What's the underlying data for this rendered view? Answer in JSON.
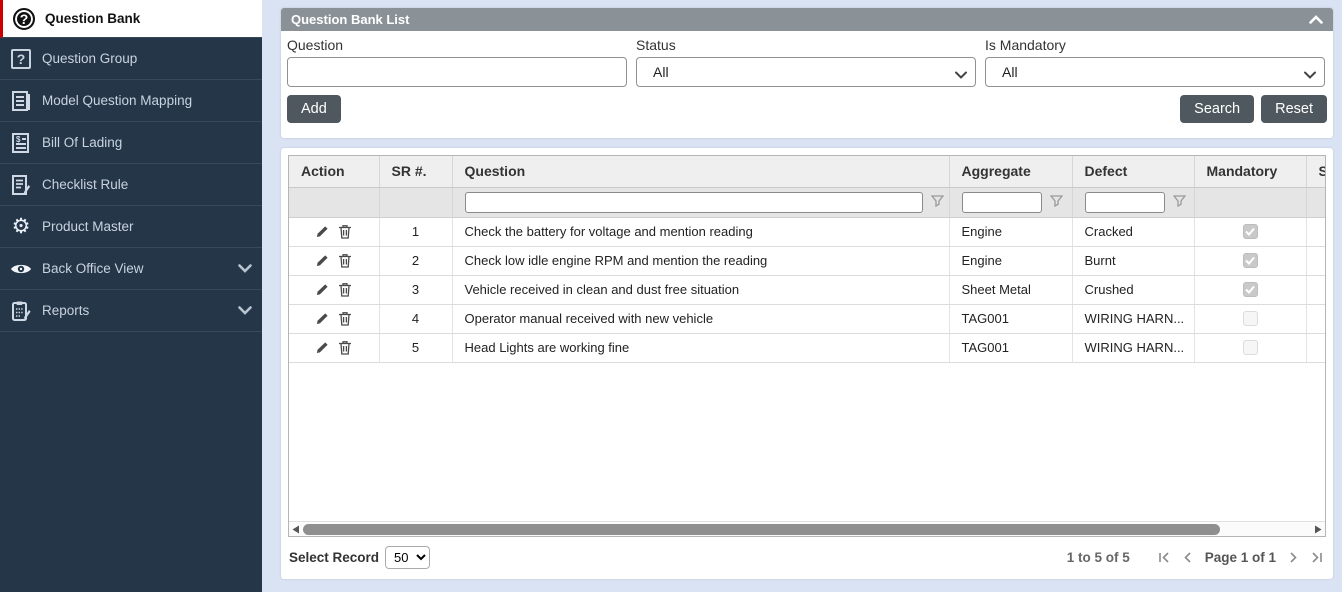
{
  "colors": {
    "sidebar_bg": "#253649",
    "active_accent": "#cc0000",
    "panel_header_bg": "#8a9298",
    "page_bg": "#d9e3f3",
    "button_bg": "#4f585f",
    "table_header_bg": "#efefef"
  },
  "sidebar": {
    "items": [
      {
        "label": "Question Bank",
        "icon": "question-circle-icon",
        "active": true
      },
      {
        "label": "Question Group",
        "icon": "question-square-icon",
        "active": false
      },
      {
        "label": "Model Question Mapping",
        "icon": "document-lines-icon",
        "active": false
      },
      {
        "label": "Bill Of Lading",
        "icon": "document-dollar-icon",
        "active": false
      },
      {
        "label": "Checklist Rule",
        "icon": "document-edit-icon",
        "active": false
      },
      {
        "label": "Product Master",
        "icon": "gear-icon",
        "active": false
      },
      {
        "label": "Back Office View",
        "icon": "eye-icon",
        "active": false,
        "expandable": true
      },
      {
        "label": "Reports",
        "icon": "clipboard-edit-icon",
        "active": false,
        "expandable": true
      }
    ]
  },
  "panel": {
    "title": "Question Bank List",
    "filters": {
      "question_label": "Question",
      "question_value": "",
      "status_label": "Status",
      "status_value": "All",
      "mandatory_label": "Is Mandatory",
      "mandatory_value": "All"
    },
    "buttons": {
      "add": "Add",
      "search": "Search",
      "reset": "Reset"
    }
  },
  "table": {
    "columns": [
      "Action",
      "SR #.",
      "Question",
      "Aggregate",
      "Defect",
      "Mandatory",
      "S"
    ],
    "rows": [
      {
        "sr": "1",
        "question": "Check the battery for voltage and mention reading",
        "aggregate": "Engine",
        "defect": "Cracked",
        "mandatory": true
      },
      {
        "sr": "2",
        "question": "Check low idle engine RPM and mention the reading",
        "aggregate": "Engine",
        "defect": "Burnt",
        "mandatory": true
      },
      {
        "sr": "3",
        "question": "Vehicle received in clean and dust free situation",
        "aggregate": "Sheet Metal",
        "defect": "Crushed",
        "mandatory": true
      },
      {
        "sr": "4",
        "question": "Operator manual received with new vehicle",
        "aggregate": "TAG001",
        "defect": "WIRING HARN...",
        "mandatory": false
      },
      {
        "sr": "5",
        "question": "Head Lights are working fine",
        "aggregate": "TAG001",
        "defect": "WIRING HARN...",
        "mandatory": false
      }
    ]
  },
  "footer": {
    "select_record_label": "Select Record",
    "select_record_value": "50",
    "range_text": "1 to 5 of 5",
    "page_text": "Page 1 of 1"
  }
}
